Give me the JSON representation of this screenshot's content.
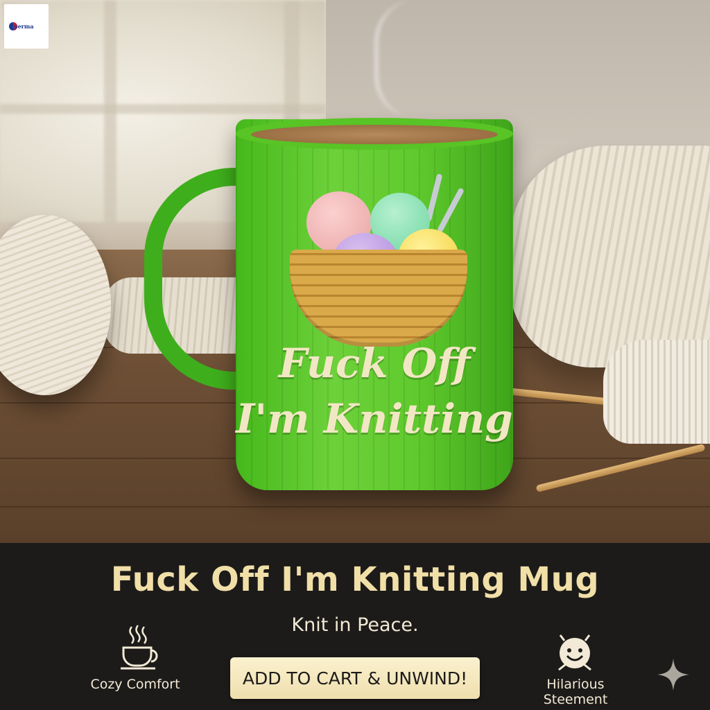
{
  "logo": {
    "text": "perma"
  },
  "mug_print": {
    "line1": "Fuck Off",
    "line2": "I'm Knitting"
  },
  "banner": {
    "title": "Fuck Off I'm Knitting Mug",
    "subtitle": "Knit in Peace.",
    "cta_label": "ADD TO CART & UNWIND!",
    "features": [
      {
        "label": "Cozy Comfort",
        "icon": "coffee-cup-icon"
      },
      {
        "label": "Hilarious Steement",
        "icon": "smiley-face-icon"
      }
    ],
    "corner_icon": "sparkle-icon"
  },
  "colors": {
    "mug_green": "#5fca2d",
    "banner_bg": "#1c1b19",
    "title_color": "#f1dfa8",
    "cta_bg": "#fbf1cf"
  }
}
